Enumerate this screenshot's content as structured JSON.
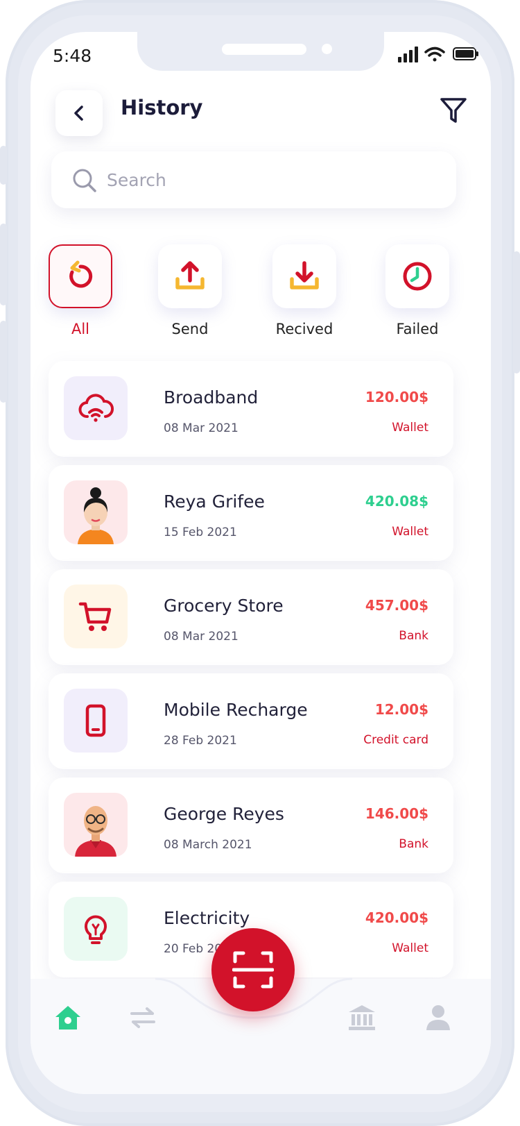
{
  "status_bar": {
    "time": "5:48"
  },
  "header": {
    "title": "History"
  },
  "search": {
    "placeholder": "Search"
  },
  "filters": [
    {
      "label": "All",
      "icon": "refresh-icon",
      "active": true
    },
    {
      "label": "Send",
      "icon": "upload-icon",
      "active": false
    },
    {
      "label": "Recived",
      "icon": "download-icon",
      "active": false
    },
    {
      "label": "Failed",
      "icon": "clock-icon",
      "active": false
    }
  ],
  "transactions": [
    {
      "title": "Broadband",
      "date": "08 Mar 2021",
      "amount": "120.00$",
      "method": "Wallet",
      "amount_color": "#f04a4a",
      "icon": "wifi-cloud-icon",
      "thumb_bg": "#f1eefb"
    },
    {
      "title": "Reya Grifee",
      "date": "15 Feb 2021",
      "amount": "420.08$",
      "method": "Wallet",
      "amount_color": "#2ecf8f",
      "icon": "woman-avatar",
      "thumb_bg": "#fde8ea"
    },
    {
      "title": "Grocery Store",
      "date": "08 Mar 2021",
      "amount": "457.00$",
      "method": "Bank",
      "amount_color": "#f04a4a",
      "icon": "cart-icon",
      "thumb_bg": "#fff6e7"
    },
    {
      "title": "Mobile Recharge",
      "date": "28 Feb 2021",
      "amount": "12.00$",
      "method": "Credit card",
      "amount_color": "#f04a4a",
      "icon": "mobile-icon",
      "thumb_bg": "#f1eefb"
    },
    {
      "title": "George Reyes",
      "date": "08 March 2021",
      "amount": "146.00$",
      "method": "Bank",
      "amount_color": "#f04a4a",
      "icon": "man-avatar",
      "thumb_bg": "#fde8ea"
    },
    {
      "title": "Electricity",
      "date": "20 Feb 2021",
      "amount": "420.00$",
      "method": "Wallet",
      "amount_color": "#f04a4a",
      "icon": "bulb-icon",
      "thumb_bg": "#eafaf2"
    }
  ],
  "colors": {
    "accent": "#d2122a",
    "positive": "#2ecf8f",
    "negative": "#f04a4a",
    "title": "#1c1c3a"
  },
  "bottom_nav": [
    {
      "icon": "home-icon",
      "active": true
    },
    {
      "icon": "transfer-icon",
      "active": false
    },
    {
      "icon": "scan-icon",
      "active": false
    },
    {
      "icon": "bank-icon",
      "active": false
    },
    {
      "icon": "profile-icon",
      "active": false
    }
  ]
}
